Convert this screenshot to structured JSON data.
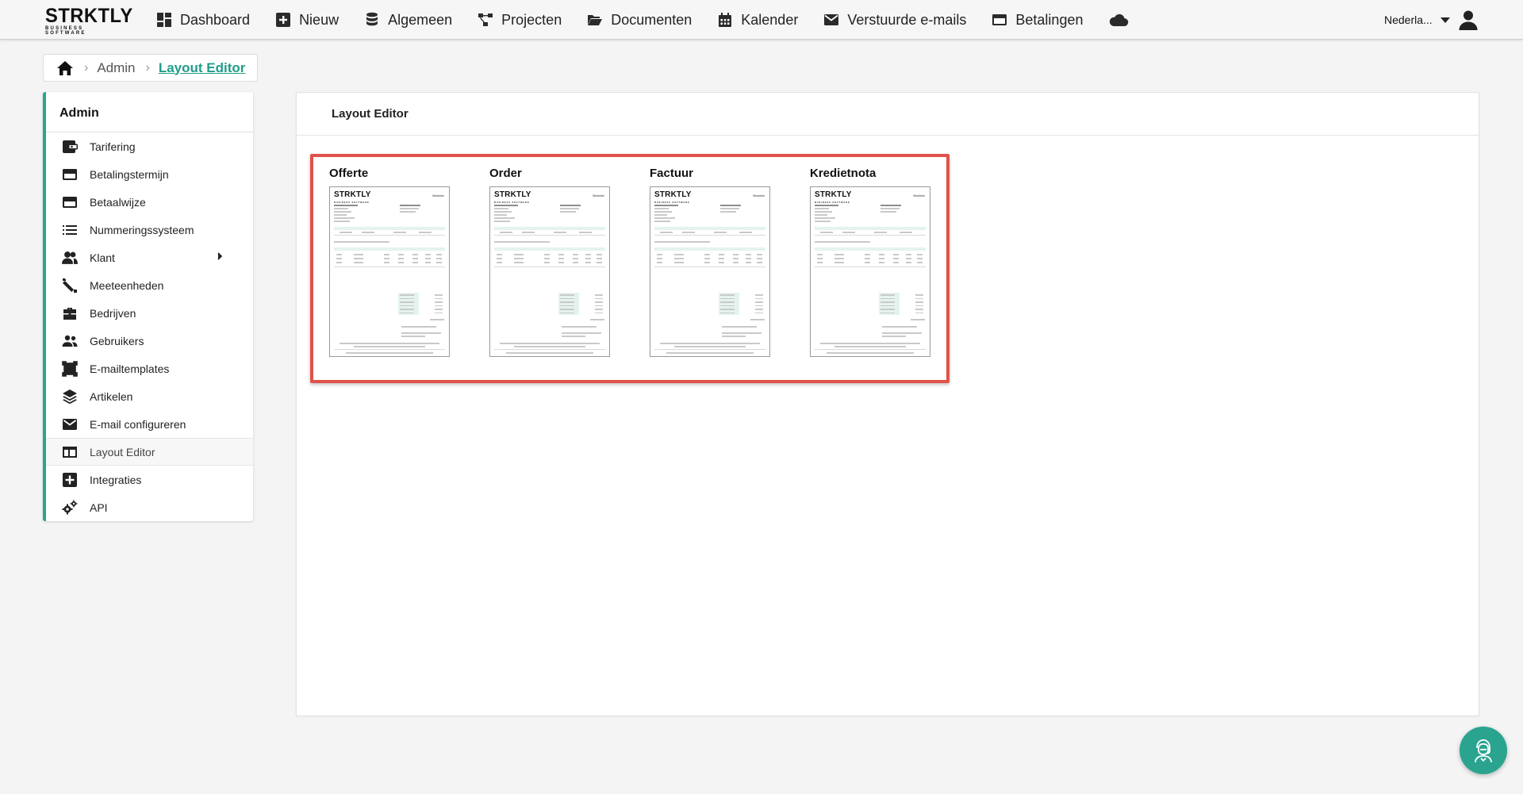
{
  "app": {
    "logo_main": "STRKTLY",
    "logo_sub": "BUSINESS SOFTWARE"
  },
  "nav": {
    "items": [
      {
        "label": "Dashboard",
        "icon": "dashboard-icon"
      },
      {
        "label": "Nieuw",
        "icon": "plus-square-icon"
      },
      {
        "label": "Algemeen",
        "icon": "database-icon"
      },
      {
        "label": "Projecten",
        "icon": "project-diagram-icon"
      },
      {
        "label": "Documenten",
        "icon": "folder-open-icon"
      },
      {
        "label": "Kalender",
        "icon": "calendar-icon"
      },
      {
        "label": "Verstuurde e-mails",
        "icon": "envelope-icon"
      },
      {
        "label": "Betalingen",
        "icon": "credit-card-icon"
      }
    ],
    "cloud_icon": "cloud-icon",
    "language": "Nederla...",
    "user_icon": "user-icon"
  },
  "breadcrumb": {
    "home_icon": "home-icon",
    "items": [
      "Admin",
      "Layout Editor"
    ]
  },
  "sidebar": {
    "title": "Admin",
    "items": [
      {
        "label": "Tarifering",
        "icon": "wallet-icon"
      },
      {
        "label": "Betalingstermijn",
        "icon": "credit-card-icon"
      },
      {
        "label": "Betaalwijze",
        "icon": "credit-card-icon"
      },
      {
        "label": "Nummeringssysteem",
        "icon": "list-icon"
      },
      {
        "label": "Klant",
        "icon": "people-icon",
        "has_submenu": true
      },
      {
        "label": "Meeteenheden",
        "icon": "ruler-icon"
      },
      {
        "label": "Bedrijven",
        "icon": "briefcase-icon"
      },
      {
        "label": "Gebruikers",
        "icon": "users-icon"
      },
      {
        "label": "E-mailtemplates",
        "icon": "template-icon"
      },
      {
        "label": "Artikelen",
        "icon": "layers-icon"
      },
      {
        "label": "E-mail configureren",
        "icon": "envelope-icon"
      },
      {
        "label": "Layout Editor",
        "icon": "layout-icon",
        "active": true
      },
      {
        "label": "Integraties",
        "icon": "plus-square-icon"
      },
      {
        "label": "API",
        "icon": "gears-icon"
      }
    ]
  },
  "main": {
    "title": "Layout Editor",
    "documents": [
      {
        "label": "Offerte"
      },
      {
        "label": "Order"
      },
      {
        "label": "Factuur"
      },
      {
        "label": "Kredietnota"
      }
    ],
    "thumbnail_logo": "STRKTLY",
    "thumbnail_logo_sub": "BUSINESS SOFTWARE",
    "thumbnail_title": "Bestelar"
  },
  "colors": {
    "accent": "#2aa48f",
    "link": "#1f9d88",
    "highlight": "#e0524a"
  },
  "chat_button_icon": "support-agent-icon"
}
